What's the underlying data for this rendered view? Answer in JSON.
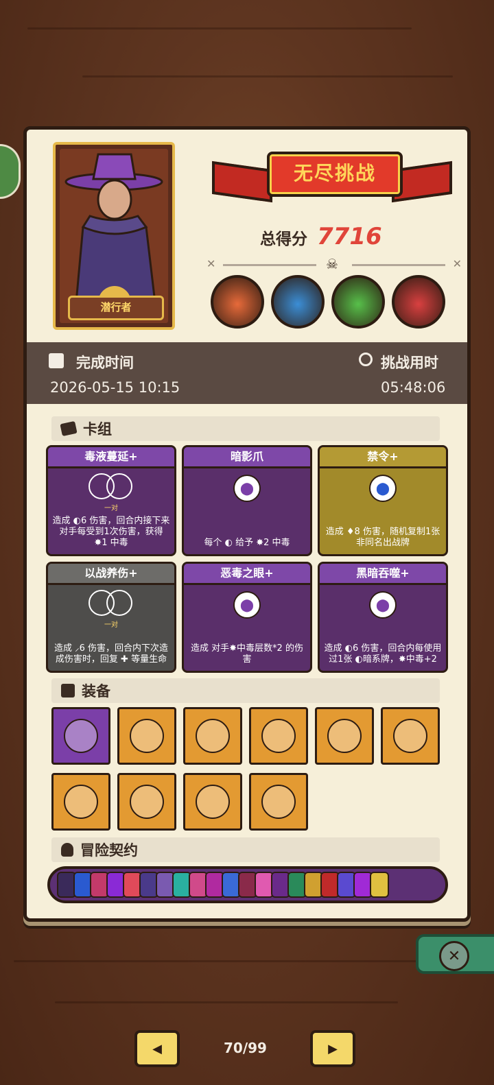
{
  "hero": {
    "name": "潜行者"
  },
  "banner": {
    "title": "无尽挑战"
  },
  "score": {
    "label": "总得分",
    "value": "7716"
  },
  "bosses": [
    {
      "icon": "eye-monster-icon",
      "color": "#e76a3a"
    },
    {
      "icon": "spider-king-icon",
      "color": "#3b8ed6"
    },
    {
      "icon": "goblin-king-icon",
      "color": "#57c04a"
    },
    {
      "icon": "red-samurai-icon",
      "color": "#d94040"
    }
  ],
  "stats": {
    "finish_label": "完成时间",
    "finish_value": "2026-05-15 10:15",
    "duration_label": "挑战用时",
    "duration_value": "05:48:06"
  },
  "deck": {
    "header": "卡组",
    "cards": [
      {
        "title": "毒液蔓延+",
        "style": "purple",
        "pair_label": "一对",
        "desc": "造成 ◐6 伤害，回合内接下来对手每受到1次伤害，获得 ✸1 中毒"
      },
      {
        "title": "暗影爪",
        "style": "purple",
        "emblem": "grapes-icon",
        "desc": "每个 ◐ 给予 ✸2 中毒"
      },
      {
        "title": "禁令+",
        "style": "olive",
        "emblem": "blueberry-icon",
        "desc": "造成 ♦8 伤害，随机复制1张非同名出战牌"
      },
      {
        "title": "以战养伤+",
        "style": "gray",
        "pair_label": "一对",
        "desc": "造成 ⸝6 伤害，回合内下次造成伤害时，回复 ✚ 等量生命"
      },
      {
        "title": "恶毒之眼+",
        "style": "purple",
        "emblem": "grapes-icon",
        "desc": "造成 对手✸中毒层数*2 的伤害"
      },
      {
        "title": "黑暗吞噬+",
        "style": "purple",
        "emblem": "grapes-icon",
        "desc": "造成 ◐6 伤害，回合内每使用过1张 ◐暗系牌，✸中毒+2"
      }
    ]
  },
  "equipment": {
    "header": "装备",
    "items": [
      {
        "icon": "spiked-dice-icon",
        "bg": "#7b3fa8"
      },
      {
        "icon": "moon-stone-icon",
        "bg": "#e39a32"
      },
      {
        "icon": "flame-roots-icon",
        "bg": "#e39a32"
      },
      {
        "icon": "blue-mushroom-icon",
        "bg": "#e39a32"
      },
      {
        "icon": "spiked-bracelet-icon",
        "bg": "#e39a32"
      },
      {
        "icon": "round-shield-icon",
        "bg": "#e39a32"
      },
      {
        "icon": "dark-cloak-icon",
        "bg": "#e39a32"
      },
      {
        "icon": "moss-tome-icon",
        "bg": "#e39a32"
      },
      {
        "icon": "crystal-shield-icon",
        "bg": "#e39a32"
      },
      {
        "icon": "ice-potion-icon",
        "bg": "#e39a32"
      }
    ]
  },
  "contract": {
    "header": "冒险契约",
    "chip_colors": [
      "#3a2a5a",
      "#2a5ad0",
      "#c33a6a",
      "#8a2ad6",
      "#e04a5a",
      "#4a3a8a",
      "#7a5ab0",
      "#2ab0a0",
      "#d04a8a",
      "#b02aa0",
      "#3a6ad6",
      "#8a2a4a",
      "#e05ab0",
      "#6a2a8a",
      "#2a8a5a",
      "#d0a030",
      "#c02a2a",
      "#5a4ad0",
      "#a02ad6",
      "#e0c040"
    ]
  },
  "nav": {
    "page": "70/99"
  }
}
